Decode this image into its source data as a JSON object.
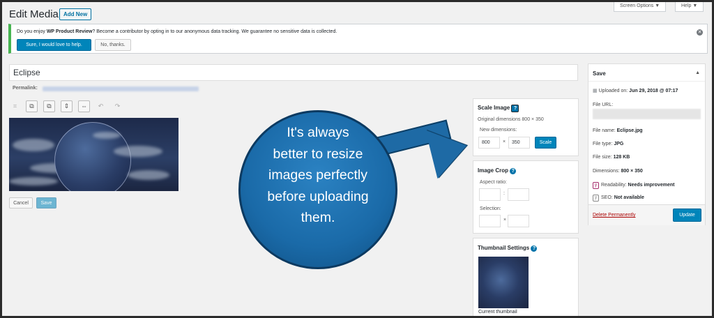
{
  "header": {
    "title": "Edit Media",
    "add_new": "Add New",
    "screen_options": "Screen Options ▼",
    "help": "Help ▼"
  },
  "notice": {
    "text_before": "Do you enjoy ",
    "text_bold": "WP Product Review",
    "text_after": "? Become a contributor by opting in to our anonymous data tracking. We guarantee no sensitive data is collected.",
    "accept": "Sure, I would love to help.",
    "decline": "No, thanks.",
    "dismiss_icon": "close-icon"
  },
  "editor": {
    "title_value": "Eclipse",
    "permalink_label": "Permalink:",
    "cancel": "Cancel",
    "save": "Save"
  },
  "callout": {
    "lines": [
      "It's always",
      "better to resize",
      "images perfectly",
      "before uploading",
      "them."
    ],
    "color": "#1a6aa8"
  },
  "scale_image": {
    "title": "Scale Image",
    "original": "Original dimensions 800 × 350",
    "new_label": "New dimensions:",
    "width": "800",
    "times": "×",
    "height": "350",
    "button": "Scale"
  },
  "image_crop": {
    "title": "Image Crop",
    "aspect": "Aspect ratio:",
    "colon": ":",
    "selection": "Selection:",
    "times": "×"
  },
  "thumbnail": {
    "title": "Thumbnail Settings",
    "current": "Current thumbnail"
  },
  "save_box": {
    "title": "Save",
    "uploaded_label": "Uploaded on: ",
    "uploaded_value": "Jun 29, 2018 @ 07:17",
    "file_url_label": "File URL:",
    "file_name_label": "File name: ",
    "file_name": "Eclipse.jpg",
    "file_type_label": "File type: ",
    "file_type": "JPG",
    "file_size_label": "File size: ",
    "file_size": "128 KB",
    "dimensions_label": "Dimensions: ",
    "dimensions": "800 × 350",
    "readability_label": "Readability: ",
    "readability": "Needs improvement",
    "seo_label": "SEO: ",
    "seo": "Not available",
    "delete": "Delete Permanently",
    "update": "Update"
  },
  "colors": {
    "primary": "#0085ba",
    "link": "#0073aa",
    "delete": "#a00",
    "notice_border": "#46b450"
  }
}
